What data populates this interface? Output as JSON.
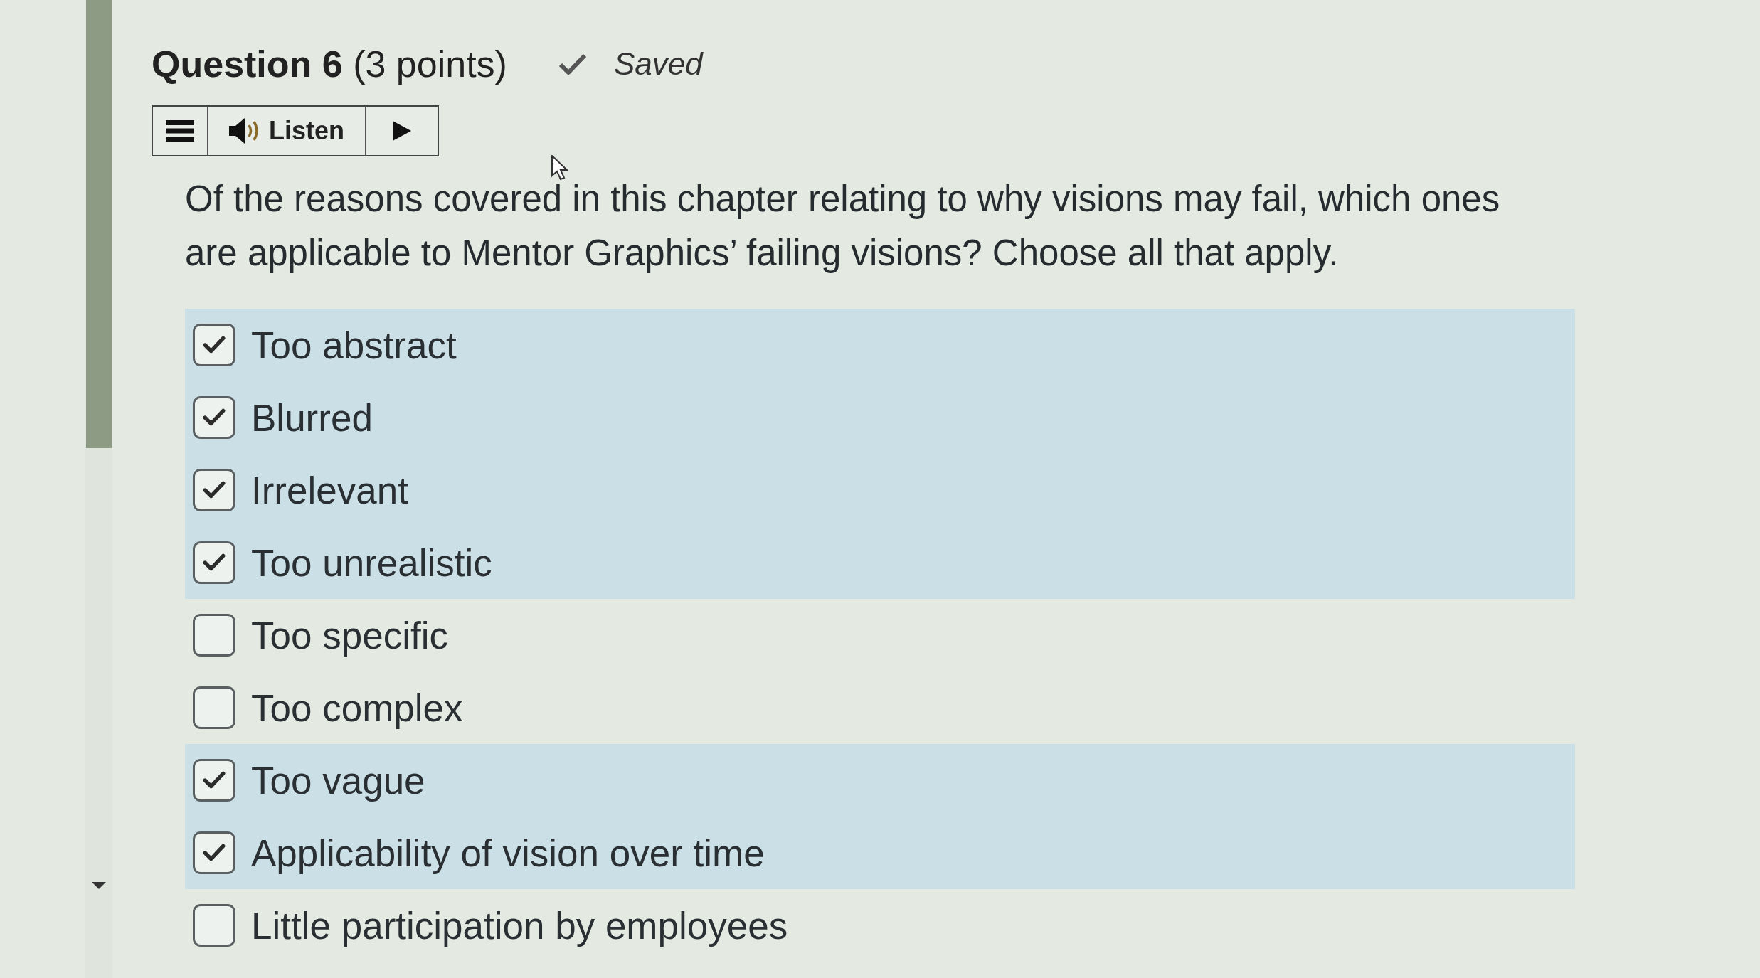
{
  "question": {
    "title": "**Question 6** (3 points)",
    "status": "Saved"
  },
  "toolbar": {
    "listen_label": "Listen"
  },
  "prompt": "Of the reasons covered in this chapter relating to why visions may fail, which ones are applicable to Mentor Graphics’ failing visions? Choose all that apply.",
  "options": [
    {
      "label": "Too abstract",
      "checked": true
    },
    {
      "label": "Blurred",
      "checked": true
    },
    {
      "label": "Irrelevant",
      "checked": true
    },
    {
      "label": "Too unrealistic",
      "checked": true
    },
    {
      "label": "Too specific",
      "checked": false
    },
    {
      "label": "Too complex",
      "checked": false
    },
    {
      "label": "Too vague",
      "checked": true
    },
    {
      "label": "Applicability of vision over time",
      "checked": true
    },
    {
      "label": "Little participation by employees",
      "checked": false
    }
  ]
}
